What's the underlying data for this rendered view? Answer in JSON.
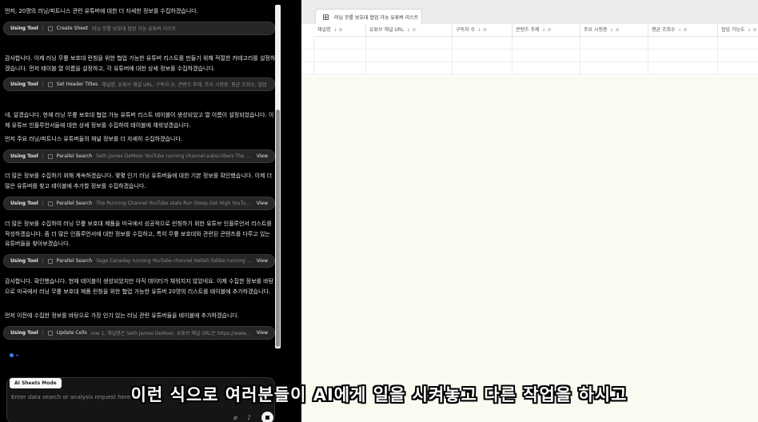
{
  "chat": {
    "messages": [
      {
        "text": "먼저, 20명의 러닝/피트니스 관련 유튜버에 대한 더 자세한 정보를 수집하겠습니다."
      },
      {
        "text": "감사합니다. 이제 러닝 무릎 보호대 런칭을 위한 협업 가능한 유튜버 리스트를 만들기 위해 적절한 카테고리를 설정하겠습니다. 먼저 테이블 열 이름을 설정하고, 각 유튜버에 대한 상세 정보를 수집하겠습니다."
      },
      {
        "text": "네, 알겠습니다. 현재 러닝 무릎 보호대 협업 가능 유튜버 리스트 테이블이 생성되었고 열 이름이 설정되었습니다. 이제 유튜브 인플루언서들에 대한 상세 정보를 수집하여 테이블에 채워넣겠습니다."
      },
      {
        "text": "먼저 주요 러닝/피트니스 유튜버들의 채널 정보를 더 자세히 수집하겠습니다."
      },
      {
        "text": "더 많은 정보를 수집하기 위해 계속하겠습니다. 몇몇 인기 러닝 유튜버들에 대한 기본 정보를 확인했습니다. 이제 더 많은 유튜버를 찾고 테이블에 추가할 정보를 수집하겠습니다."
      },
      {
        "text": "더 많은 정보를 수집하여 러닝 무릎 보호대 제품을 미국에서 성공적으로 런칭하기 위한 유튜브 인플루언서 리스트를 작성하겠습니다. 좀 더 많은 인플루언서에 대한 정보를 수집하고, 특히 무릎 보호대와 관련된 콘텐츠를 다루고 있는 유튜버들을 찾아보겠습니다."
      },
      {
        "text": "감사합니다. 확인했습니다. 현재 테이블이 생성되었지만 아직 데이터가 채워지지 않았네요. 이제 수집한 정보를 바탕으로 미국에서 러닝 무릎 보호대 제품 런칭을 위한 협업 가능한 유튜버 20명의 리스트를 테이블에 추가하겠습니다."
      },
      {
        "text": "먼저 이전에 수집한 정보를 바탕으로 가장 인기 있는 러닝 관련 유튜버들을 테이블에 추가하겠습니다."
      }
    ],
    "tools": [
      {
        "label": "Using Tool",
        "sep": "|",
        "name": "Create Sheet",
        "arg": "러닝 무릎 보호대 협업 가능 유튜버 리스트",
        "view": ""
      },
      {
        "label": "Using Tool",
        "sep": "|",
        "name": "Set Header Titles",
        "arg": "채널명, 유튜브 채널 URL, 구독자 수, 콘텐츠 주제, 주요 시청층, 평균 조회수, 협업",
        "view": ""
      },
      {
        "label": "Using Tool",
        "sep": "|",
        "name": "Parallel Search",
        "arg": "Seth James DeMoor YouTube running channel subscribers The Ginger Runner YouTube",
        "view": "View"
      },
      {
        "label": "Using Tool",
        "sep": "|",
        "name": "Parallel Search",
        "arg": "The Running Channel YouTube stats Run Steep Get High YouTube stats Sage Canaday",
        "view": "View"
      },
      {
        "label": "Using Tool",
        "sep": "|",
        "name": "Parallel Search",
        "arg": "Sage Canaday running YouTube channel Hellah Sidibe running YouTube channel stats",
        "view": "View"
      },
      {
        "label": "Using Tool",
        "sep": "|",
        "name": "Update Cells",
        "arg": "row 1, 채널명은 Seth James DeMoor, 유튜브 채널 URL은 https://www.youtube.com/...",
        "view": "View"
      }
    ],
    "mode_chip": "AI Sheets Mode",
    "input_placeholder": "Enter data search or analysis request here..."
  },
  "sheet": {
    "tab_title": "러닝 무릎 보호대 협업 가능 유튜버 리스트",
    "columns": [
      "채널명",
      "유튜브 채널 URL",
      "구독자 수",
      "콘텐츠 주제",
      "주요 시청층",
      "평균 조회수",
      "협업 가능도"
    ],
    "sort_glyph": "↓ ⊘"
  },
  "subtitle": "이런 식으로 여러분들이 AI에게 일을 시켜놓고 다른 작업을 하시고"
}
